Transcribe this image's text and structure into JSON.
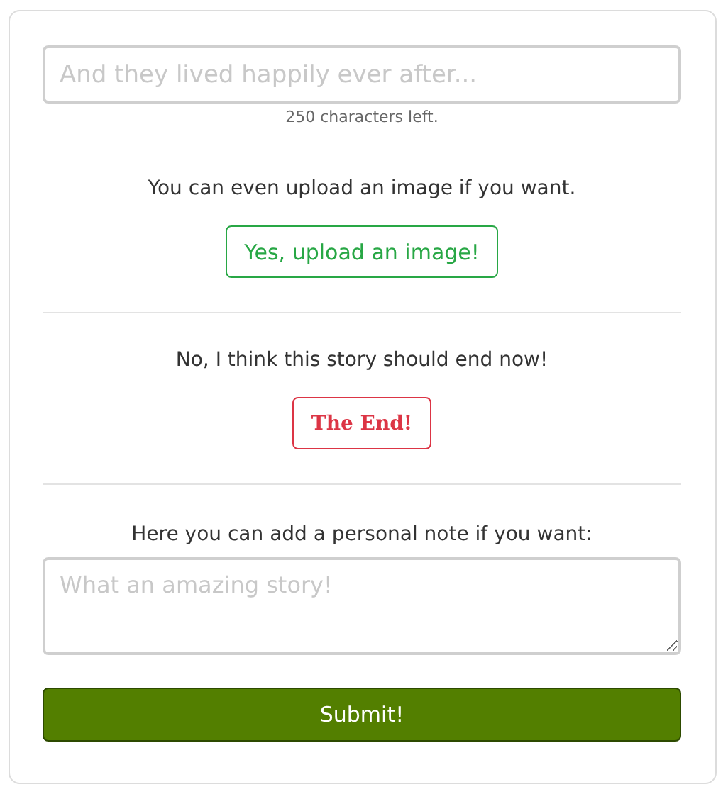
{
  "story_field": {
    "placeholder": "And they lived happily ever after..."
  },
  "counter": "250 characters left.",
  "upload": {
    "prompt": "You can even upload an image if you want.",
    "button": "Yes, upload an image!"
  },
  "ending": {
    "prompt": "No, I think this story should end now!",
    "button": "The End!"
  },
  "note": {
    "label": "Here you can add a personal note if you want:",
    "placeholder": "What an amazing story!"
  },
  "submit": "Submit!"
}
